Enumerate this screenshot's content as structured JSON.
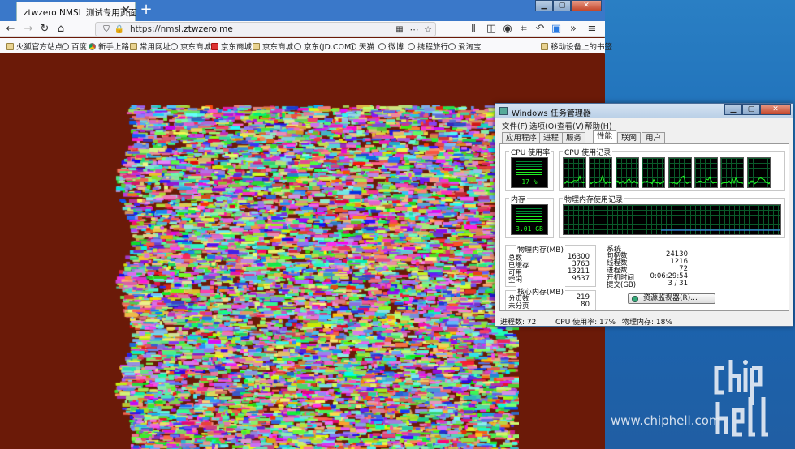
{
  "firefox": {
    "tab_title": "ztwzero NMSL 测试专用页面",
    "tab_close": "✕",
    "new_tab": "+",
    "url_prefix": "https://nmsl.",
    "url_domain": "ztwzero.me",
    "bookmarks": [
      "火狐官方站点",
      "百度",
      "新手上路",
      "常用网址",
      "京东商城",
      "京东商城",
      "京东商城",
      "京东(JD.COM)",
      "天猫",
      "微博",
      "携程旅行",
      "爱淘宝"
    ],
    "mobile_bookmarks": "移动设备上的书签"
  },
  "taskmgr": {
    "title": "Windows 任务管理器",
    "menu": [
      "文件(F)",
      "选项(O)",
      "查看(V)",
      "帮助(H)"
    ],
    "tabs": [
      "应用程序",
      "进程",
      "服务",
      "性能",
      "联网",
      "用户"
    ],
    "active_tab": "性能",
    "cpu_usage_label": "CPU 使用率",
    "cpu_usage_value": "17 %",
    "cpu_history_label": "CPU 使用记录",
    "memory_label": "内存",
    "memory_value": "3.01 GB",
    "memory_history_label": "物理内存使用记录",
    "physical_memory": {
      "title": "物理内存(MB)",
      "rows": [
        [
          "总数",
          "16300"
        ],
        [
          "已缓存",
          "3763"
        ],
        [
          "可用",
          "13211"
        ],
        [
          "空闲",
          "9537"
        ]
      ]
    },
    "kernel_memory": {
      "title": "核心内存(MB)",
      "rows": [
        [
          "分页数",
          "219"
        ],
        [
          "未分页",
          "80"
        ]
      ]
    },
    "system": {
      "title": "系统",
      "rows": [
        [
          "句柄数",
          "24130"
        ],
        [
          "线程数",
          "1216"
        ],
        [
          "进程数",
          "72"
        ],
        [
          "开机时间",
          "0:06:29:54"
        ],
        [
          "提交(GB)",
          "3 / 31"
        ]
      ]
    },
    "resource_monitor_button": "资源监视器(R)...",
    "status": {
      "processes": "进程数: 72",
      "cpu": "CPU 使用率: 17%",
      "memory": "物理内存: 18%"
    }
  },
  "watermark": {
    "url": "www.chiphell.com",
    "logo_text": "chip hell"
  },
  "colors": {
    "page_background": "#6b1a08",
    "desktop": "#1e6fb8",
    "meter_green": "#22ee22"
  },
  "cpu_core_count": 8
}
